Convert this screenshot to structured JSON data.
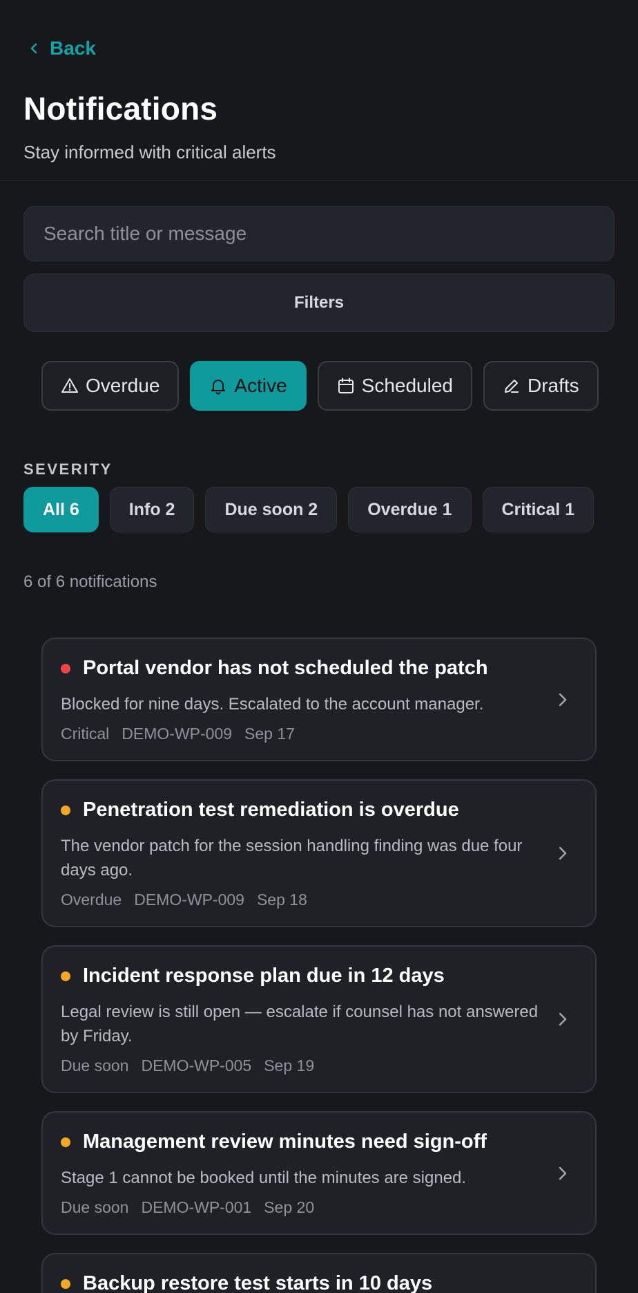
{
  "header": {
    "back_label": "Back",
    "title": "Notifications",
    "subtitle": "Stay informed with critical alerts"
  },
  "search": {
    "placeholder": "Search title or message",
    "value": ""
  },
  "filters": {
    "label": "Filters"
  },
  "tabs": [
    {
      "label": "Overdue",
      "icon": "warning-icon",
      "active": false
    },
    {
      "label": "Active",
      "icon": "bell-icon",
      "active": true
    },
    {
      "label": "Scheduled",
      "icon": "calendar-icon",
      "active": false
    },
    {
      "label": "Drafts",
      "icon": "pencil-icon",
      "active": false
    }
  ],
  "severity": {
    "label": "SEVERITY",
    "chips": [
      {
        "label": "All 6",
        "active": true
      },
      {
        "label": "Info 2",
        "active": false
      },
      {
        "label": "Due soon 2",
        "active": false
      },
      {
        "label": "Overdue 1",
        "active": false
      },
      {
        "label": "Critical 1",
        "active": false
      }
    ]
  },
  "count_text": "6 of 6 notifications",
  "colors": {
    "accent": "#0f9a9c",
    "critical": "#ef4444",
    "warning": "#f5a623"
  },
  "notifications": [
    {
      "title": "Portal vendor has not scheduled the patch",
      "message": "Blocked for nine days. Escalated to the account manager.",
      "severity": "Critical",
      "ref": "DEMO-WP-009",
      "date": "Sep 17",
      "dot_color": "#ef4444"
    },
    {
      "title": "Penetration test remediation is overdue",
      "message": "The vendor patch for the session handling finding was due four days ago.",
      "severity": "Overdue",
      "ref": "DEMO-WP-009",
      "date": "Sep 18",
      "dot_color": "#f5a623"
    },
    {
      "title": "Incident response plan due in 12 days",
      "message": "Legal review is still open — escalate if counsel has not answered by Friday.",
      "severity": "Due soon",
      "ref": "DEMO-WP-005",
      "date": "Sep 19",
      "dot_color": "#f5a623"
    },
    {
      "title": "Management review minutes need sign-off",
      "message": "Stage 1 cannot be booked until the minutes are signed.",
      "severity": "Due soon",
      "ref": "DEMO-WP-001",
      "date": "Sep 20",
      "dot_color": "#f5a623"
    },
    {
      "title": "Backup restore test starts in 10 days",
      "message": "",
      "severity": "",
      "ref": "",
      "date": "",
      "dot_color": "#f5a623"
    }
  ]
}
